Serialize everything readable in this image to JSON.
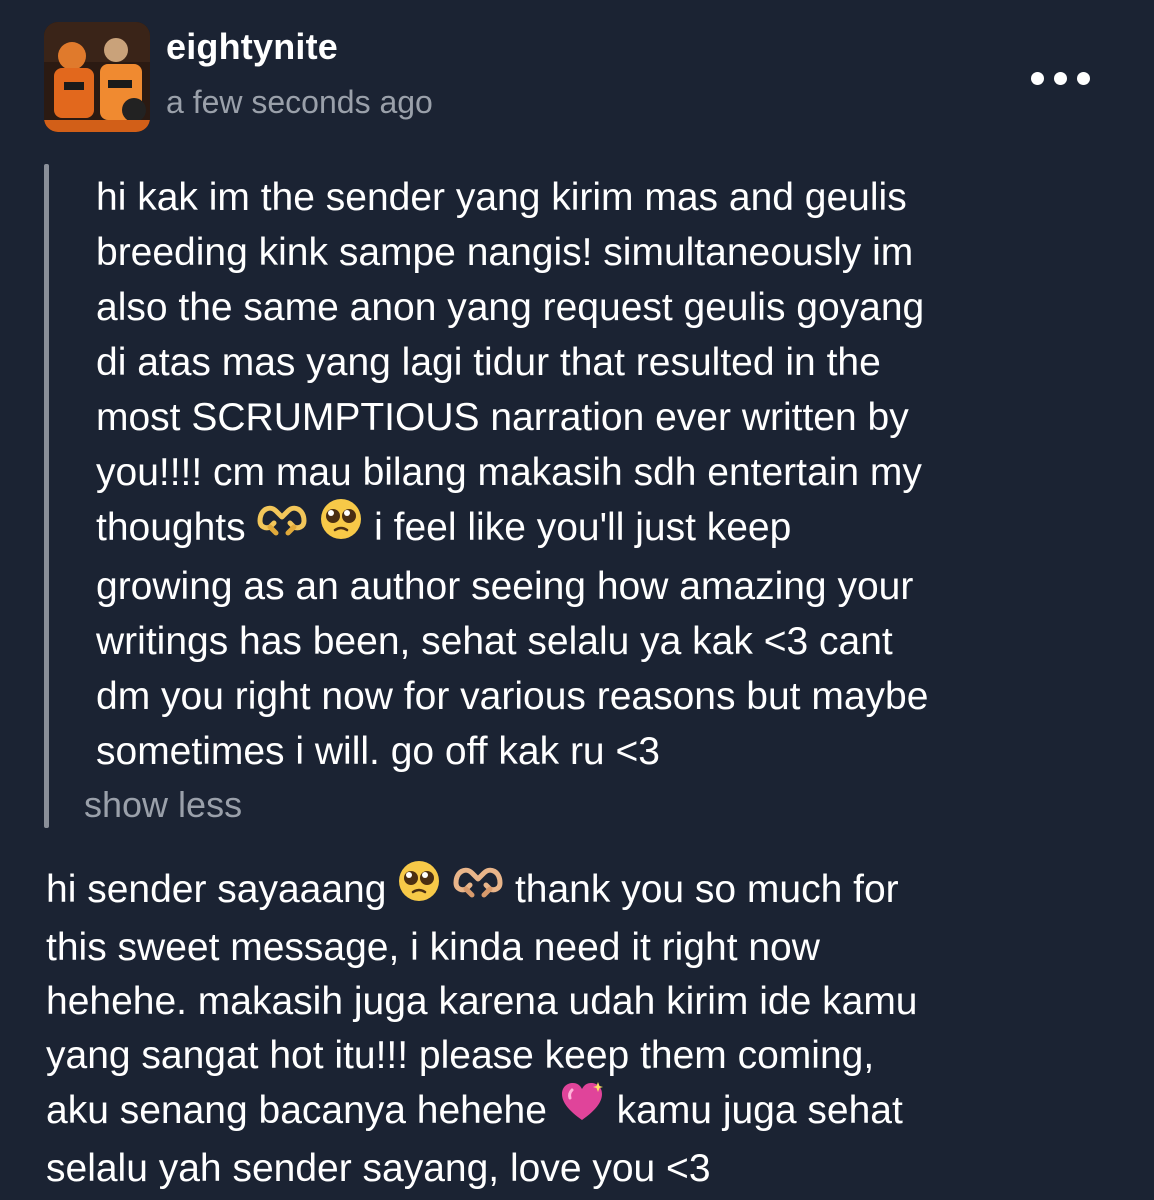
{
  "header": {
    "username": "eightynite",
    "timestamp": "a few seconds ago",
    "more_icon": "more-horizontal-icon"
  },
  "ask": {
    "lines": [
      "hi kak im the sender yang kirim mas and geulis",
      "breeding kink sampe nangis! simultaneously im",
      "also the same anon yang request geulis goyang",
      "di atas mas yang lagi tidur that resulted in the",
      "most SCRUMPTIOUS narration ever written by",
      "you!!!! cm mau bilang makasih sdh entertain my"
    ],
    "line7_before_emoji": "thoughts",
    "line7_after_emoji": "i feel like you'll just keep",
    "lines_after": [
      "growing as an author seeing how amazing your",
      "writings has been, sehat selalu ya kak <3 cant",
      "dm you right now for various reasons but maybe",
      "sometimes i will. go off kak ru <3"
    ],
    "show_less_label": "show less"
  },
  "answer": {
    "line1_before_emoji": "hi sender sayaaang",
    "line1_after_emoji": "thank you so much for",
    "lines_mid": [
      "this sweet message, i kinda need it right now",
      "hehehe. makasih juga karena udah kirim ide kamu",
      "yang sangat hot itu!!! please keep them coming,"
    ],
    "line5_before_emoji": "aku senang bacanya hehehe",
    "line5_after_emoji": "kamu juga sehat",
    "line6": "selalu yah sender sayang, love you <3"
  },
  "icons": {
    "heart_hands": "heart-hands-emoji",
    "pleading_face": "pleading-face-emoji",
    "sparkling_heart": "sparkling-heart-emoji"
  }
}
